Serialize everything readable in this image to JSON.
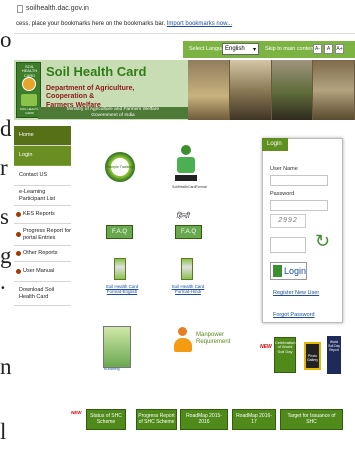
{
  "left_fragment": [
    "o",
    "d",
    "r",
    "s",
    "g",
    ".",
    " n",
    "l"
  ],
  "browser": {
    "url": "soilhealth.dac.gov.in",
    "bookmarks_text": "cess, place your bookmarks here on the bookmarks bar.",
    "bookmarks_link": "Import bookmarks now..."
  },
  "topbar": {
    "select_language_label": "Select Language",
    "language_value": "English",
    "skip_label": "Skip to main content",
    "font_sizes": [
      "A-",
      "A",
      "A+"
    ]
  },
  "header": {
    "logo_top": "SOIL HEALTH CARD",
    "logo_bottom": "SOIL HEALTH CARD",
    "title": "Soil Health Card",
    "department_line1": "Department of Agriculture, Cooperation &",
    "department_line2": "Farmers Welfare",
    "ministry_line1": "Ministry of Agriculture and Farmers Welfare",
    "ministry_line2": "Government of India"
  },
  "nav": {
    "items": [
      "Home",
      "Login",
      "Contact US",
      "e-Learning Participant List",
      "KES Reports",
      "Progress Report for portal Entries",
      "Other Reports",
      "User Manual",
      "Download Soil Health Card"
    ]
  },
  "center": {
    "sample_tracking": "Sample Tracking",
    "soil_health_card_label": "SoilHealthCardFormat",
    "faq": "F.A.Q",
    "faq_hindi": "हिन्दी",
    "format_english": "Soil Health Card Format-English",
    "format_hindi": "Soil Health Card Format-Hindi",
    "elearning": "eLearning",
    "manpower": "Manpower Requirement"
  },
  "login": {
    "header": "Login",
    "username_label": "User Name",
    "password_label": "Password",
    "captcha_text": "2992",
    "login_button": "Login",
    "register_link": "Register New User",
    "forgot_link": "Forgot Password"
  },
  "badges": {
    "new": "NEW",
    "celebration": "Celebration of World Soil Day",
    "photo_gallery": "Photo Gallery",
    "world_soil_day": "World Soil Day Report"
  },
  "bottom_buttons": [
    "Status of SHC Scheme",
    "Progress Report of SHC Scheme",
    "RoadMap 2015-2016",
    "RoadMap 2016-17",
    "Target for Issuance of SHC"
  ],
  "colors": {
    "brand_green": "#2f7d18",
    "nav_green": "#6b8e23",
    "header_bg": "#c9ddb4",
    "link_blue": "#1a4fa0"
  }
}
